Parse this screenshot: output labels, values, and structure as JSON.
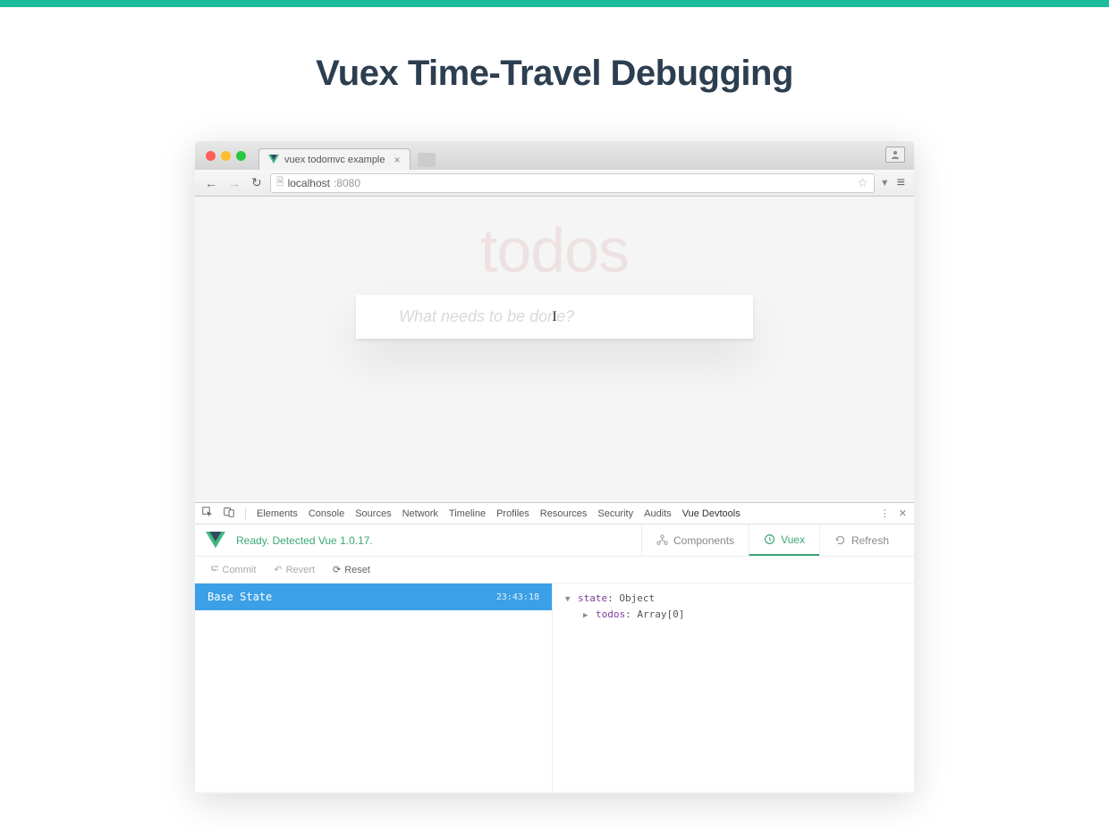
{
  "slide": {
    "title": "Vuex Time-Travel Debugging"
  },
  "browser": {
    "tab_title": "vuex todomvc example",
    "url_host": "localhost",
    "url_port": ":8080"
  },
  "app": {
    "heading": "todos",
    "input_placeholder": "What needs to be done?"
  },
  "devtools": {
    "tabs": [
      "Elements",
      "Console",
      "Sources",
      "Network",
      "Timeline",
      "Profiles",
      "Resources",
      "Security",
      "Audits",
      "Vue Devtools"
    ],
    "vue": {
      "status": "Ready. Detected Vue 1.0.17.",
      "header_tabs": {
        "components": "Components",
        "vuex": "Vuex",
        "refresh": "Refresh"
      },
      "actions": {
        "commit": "Commit",
        "revert": "Revert",
        "reset": "Reset"
      },
      "mutation": {
        "label": "Base State",
        "time": "23:43:18"
      },
      "state": {
        "root_key": "state",
        "root_val": "Object",
        "child_key": "todos",
        "child_val": "Array[0]"
      }
    }
  }
}
